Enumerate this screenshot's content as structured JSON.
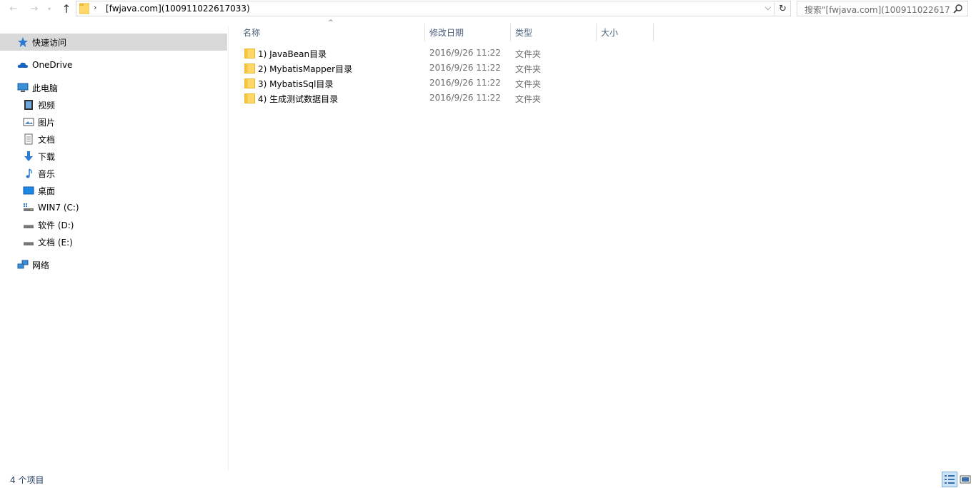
{
  "window": {
    "address_path": "[fwjava.com](100911022617033)",
    "search_placeholder": "搜索\"[fwjava.com](100911022617...",
    "nav": {
      "back_icon": "arrow-left-icon",
      "forward_icon": "arrow-right-icon",
      "recent_icon": "chevron-down-icon",
      "up_icon": "arrow-up-icon",
      "address_separator": "›",
      "address_dropdown": "⌵",
      "refresh": "↻"
    }
  },
  "sidebar": {
    "items": [
      {
        "label": "快速访问",
        "icon": "star-icon",
        "level": 0,
        "selected": true
      },
      {
        "label": "OneDrive",
        "icon": "cloud-icon",
        "level": 0
      },
      {
        "label": "此电脑",
        "icon": "computer-icon",
        "level": 0
      },
      {
        "label": "视频",
        "icon": "video-icon",
        "level": 1
      },
      {
        "label": "图片",
        "icon": "pictures-icon",
        "level": 1
      },
      {
        "label": "文档",
        "icon": "documents-icon",
        "level": 1
      },
      {
        "label": "下载",
        "icon": "download-icon",
        "level": 1
      },
      {
        "label": "音乐",
        "icon": "music-icon",
        "level": 1
      },
      {
        "label": "桌面",
        "icon": "desktop-icon",
        "level": 1
      },
      {
        "label": "WIN7 (C:)",
        "icon": "system-drive-icon",
        "level": 1
      },
      {
        "label": "软件 (D:)",
        "icon": "drive-icon",
        "level": 1
      },
      {
        "label": "文档 (E:)",
        "icon": "drive-icon",
        "level": 1
      },
      {
        "label": "网络",
        "icon": "network-icon",
        "level": 0
      }
    ]
  },
  "columns": {
    "name": "名称",
    "modified": "修改日期",
    "type": "类型",
    "size": "大小",
    "sort_indicator": "^"
  },
  "files": [
    {
      "name": "1) JavaBean目录",
      "modified": "2016/9/26 11:22",
      "type": "文件夹",
      "icon": "folder-icon"
    },
    {
      "name": "2) MybatisMapper目录",
      "modified": "2016/9/26 11:22",
      "type": "文件夹",
      "icon": "folder-icon"
    },
    {
      "name": "3) MybatisSql目录",
      "modified": "2016/9/26 11:22",
      "type": "文件夹",
      "icon": "folder-icon"
    },
    {
      "name": "4) 生成测试数据目录",
      "modified": "2016/9/26 11:22",
      "type": "文件夹",
      "icon": "folder-icon"
    }
  ],
  "status": {
    "item_count": "4 个项目",
    "views": [
      "details-view-icon",
      "large-icons-view-icon"
    ]
  },
  "colors": {
    "folder": "#ffd868",
    "folder_dark": "#e8b830",
    "selected_sidebar": "#d9d9d9",
    "header_text": "#4c607a",
    "accent": "#0078d7"
  }
}
